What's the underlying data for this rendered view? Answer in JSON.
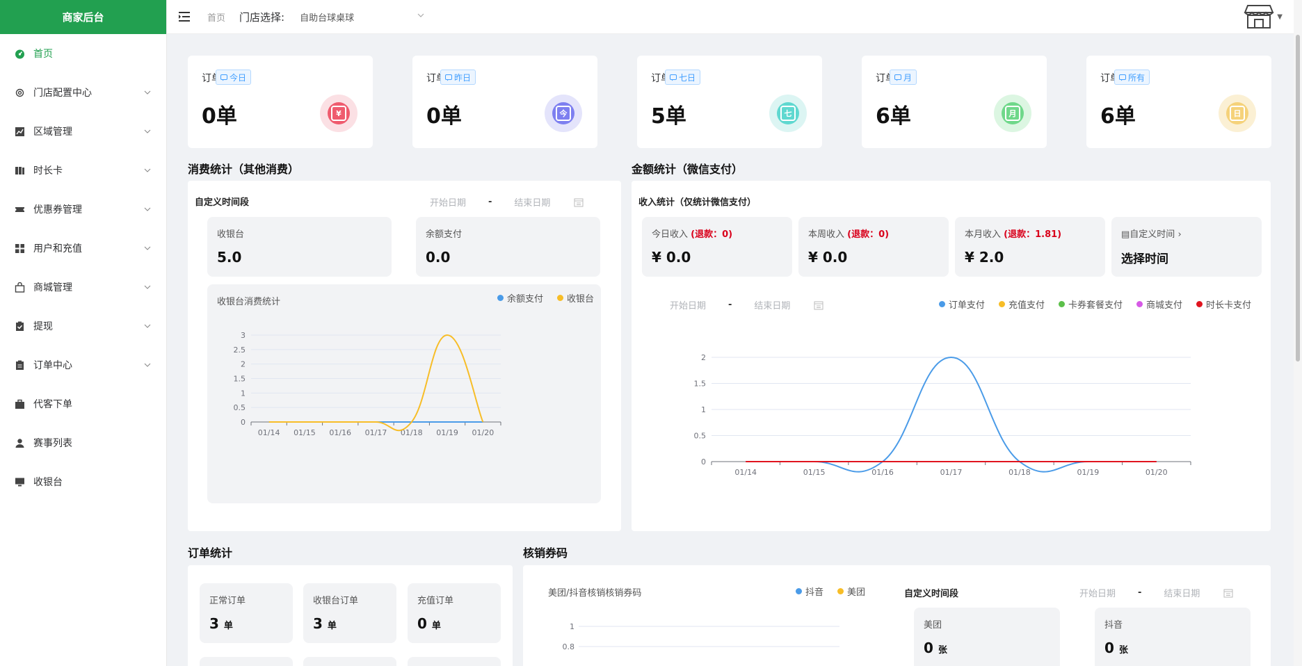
{
  "app": {
    "brand": "商家后台"
  },
  "sidebar": {
    "items": [
      {
        "label": "首页",
        "icon": "dashboard-icon",
        "active": true,
        "expandable": false
      },
      {
        "label": "门店配置中心",
        "icon": "gear-icon",
        "expandable": true
      },
      {
        "label": "区域管理",
        "icon": "chart-icon",
        "expandable": true
      },
      {
        "label": "时长卡",
        "icon": "book-icon",
        "expandable": true
      },
      {
        "label": "优惠券管理",
        "icon": "ticket-icon",
        "expandable": true
      },
      {
        "label": "用户和充值",
        "icon": "grid-icon",
        "expandable": true
      },
      {
        "label": "商城管理",
        "icon": "bag-icon",
        "expandable": true
      },
      {
        "label": "提现",
        "icon": "clipboard-check-icon",
        "expandable": true
      },
      {
        "label": "订单中心",
        "icon": "clipboard-icon",
        "expandable": true
      },
      {
        "label": "代客下单",
        "icon": "briefcase-icon",
        "expandable": false
      },
      {
        "label": "赛事列表",
        "icon": "user-icon",
        "expandable": false
      },
      {
        "label": "收银台",
        "icon": "monitor-icon",
        "expandable": false
      }
    ]
  },
  "header": {
    "breadcrumb": "首页",
    "store_label": "门店选择:",
    "store_value": "自助台球桌球"
  },
  "stats": [
    {
      "label": "订单",
      "tag": "今日",
      "value": "0单",
      "glyph": "¥",
      "color": "#ef5b6e",
      "halo": "#fbe0e4"
    },
    {
      "label": "订单",
      "tag": "昨日",
      "value": "0单",
      "glyph": "今",
      "color": "#7d7ff0",
      "halo": "#e4e4fb"
    },
    {
      "label": "订单",
      "tag": "七日",
      "value": "5单",
      "glyph": "七",
      "color": "#5fd8d0",
      "halo": "#dcf5f3"
    },
    {
      "label": "订单",
      "tag": "月",
      "value": "6单",
      "glyph": "月",
      "color": "#6fd88a",
      "halo": "#dcf6e2"
    },
    {
      "label": "订单",
      "tag": "所有",
      "value": "6单",
      "glyph": "日",
      "color": "#f5d27a",
      "halo": "#fbf0d4"
    }
  ],
  "consumption": {
    "title": "消费统计（其他消费）",
    "custom_range": "自定义时间段",
    "start_placeholder": "开始日期",
    "end_placeholder": "结束日期",
    "dash": "-",
    "boxes": [
      {
        "label": "收银台",
        "value": "5.0"
      },
      {
        "label": "余额支付",
        "value": "0.0"
      }
    ],
    "chart_title": "收银台消费统计"
  },
  "amount": {
    "title": "金额统计（微信支付）",
    "sub": "收入统计（仅统计微信支付）",
    "boxes": [
      {
        "label": "今日收入",
        "refund": "(退款：0)",
        "value": "¥ 0.0"
      },
      {
        "label": "本周收入",
        "refund": "(退款：0)",
        "value": "¥ 0.0"
      },
      {
        "label": "本月收入",
        "refund": "(退款：1.81)",
        "value": "¥ 2.0"
      }
    ],
    "custom_time": "自定义时间",
    "choose_time": "选择时间",
    "start_placeholder": "开始日期",
    "end_placeholder": "结束日期",
    "dash": "-"
  },
  "orders": {
    "title": "订单统计",
    "boxes": [
      {
        "label": "正常订单",
        "value": "3",
        "unit": "单"
      },
      {
        "label": "收银台订单",
        "value": "3",
        "unit": "单"
      },
      {
        "label": "充值订单",
        "value": "0",
        "unit": "单"
      }
    ]
  },
  "coupons": {
    "title": "核销券码",
    "chart_title": "美团/抖音核销核销券码",
    "custom_range": "自定义时间段",
    "start_placeholder": "开始日期",
    "end_placeholder": "结束日期",
    "dash": "-",
    "boxes": [
      {
        "label": "美团",
        "value": "0",
        "unit": "张"
      },
      {
        "label": "抖音",
        "value": "0",
        "unit": "张"
      }
    ]
  },
  "chart_data": [
    {
      "type": "line",
      "title": "收银台消费统计",
      "categories": [
        "01/14",
        "01/15",
        "01/16",
        "01/17",
        "01/18",
        "01/19",
        "01/20"
      ],
      "ylim": [
        0,
        3
      ],
      "yticks": [
        "0",
        "0.5",
        "1",
        "1.5",
        "2",
        "2.5",
        "3"
      ],
      "series": [
        {
          "name": "余额支付",
          "color": "#4a9be8",
          "values": [
            0,
            0,
            0,
            0,
            0,
            0,
            0
          ]
        },
        {
          "name": "收银台",
          "color": "#f7bd27",
          "values": [
            0,
            0,
            0,
            0,
            0,
            3,
            0
          ]
        }
      ],
      "legend": "top-right"
    },
    {
      "type": "line",
      "categories": [
        "01/14",
        "01/15",
        "01/16",
        "01/17",
        "01/18",
        "01/19",
        "01/20"
      ],
      "ylim": [
        0,
        2
      ],
      "yticks": [
        "0",
        "0.5",
        "1",
        "1.5",
        "2"
      ],
      "series": [
        {
          "name": "订单支付",
          "color": "#4a9be8",
          "values": [
            0,
            0,
            0,
            2,
            0,
            0,
            0
          ]
        },
        {
          "name": "充值支付",
          "color": "#f7bd27",
          "values": [
            0,
            0,
            0,
            0,
            0,
            0,
            0
          ]
        },
        {
          "name": "卡券套餐支付",
          "color": "#5cc04a",
          "values": [
            0,
            0,
            0,
            0,
            0,
            0,
            0
          ]
        },
        {
          "name": "商城支付",
          "color": "#d65ae6",
          "values": [
            0,
            0,
            0,
            0,
            0,
            0,
            0
          ]
        },
        {
          "name": "时长卡支付",
          "color": "#e0141e",
          "values": [
            0,
            0,
            0,
            0,
            0,
            0,
            0
          ]
        }
      ],
      "legend": "top-right"
    },
    {
      "type": "line",
      "title": "美团/抖音核销核销券码",
      "yticks": [
        "0.8",
        "1"
      ],
      "series": [
        {
          "name": "抖音",
          "color": "#4a9be8"
        },
        {
          "name": "美团",
          "color": "#f7bd27"
        }
      ],
      "legend": "top-right"
    }
  ]
}
